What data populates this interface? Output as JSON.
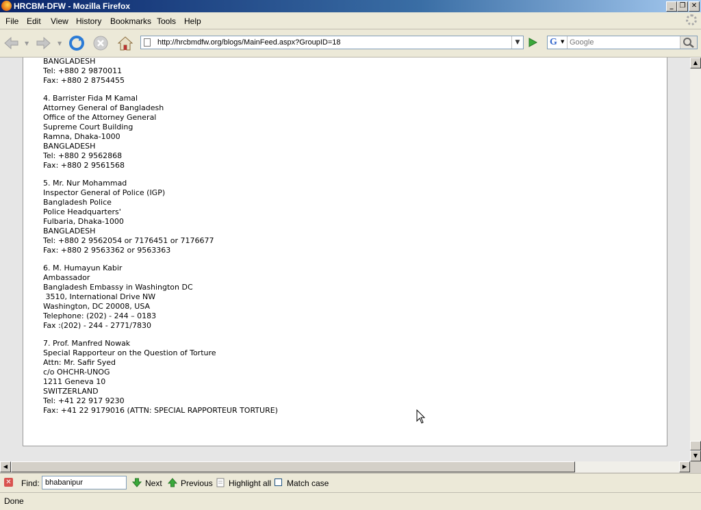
{
  "window": {
    "title": "HRCBM-DFW - Mozilla Firefox"
  },
  "menu": [
    "File",
    "Edit",
    "View",
    "History",
    "Bookmarks",
    "Tools",
    "Help"
  ],
  "nav": {
    "url": "http://hrcbmdfw.org/blogs/MainFeed.aspx?GroupID=18",
    "search_placeholder": "Google",
    "search_engine": "G"
  },
  "content": {
    "blocks": [
      [
        "BANGLADESH",
        "Tel: +880 2 9870011",
        "Fax: +880 2 8754455"
      ],
      [
        "4. Barrister Fida M Kamal",
        "Attorney General of Bangladesh",
        "Office of the Attorney General",
        "Supreme Court Building",
        "Ramna, Dhaka-1000",
        "BANGLADESH",
        "Tel: +880 2 9562868",
        "Fax: +880 2 9561568"
      ],
      [
        "5. Mr. Nur Mohammad",
        "Inspector General of Police (IGP)",
        "Bangladesh Police",
        "Police Headquarters'",
        "Fulbaria, Dhaka-1000",
        "BANGLADESH",
        "Tel: +880 2 9562054 or 7176451 or 7176677",
        "Fax: +880 2 9563362 or 9563363"
      ],
      [
        "6. M. Humayun Kabir",
        "Ambassador",
        "Bangladesh Embassy in Washington DC",
        " 3510, International Drive NW",
        "Washington, DC 20008, USA",
        "Telephone: (202) - 244 – 0183",
        "Fax :(202) - 244 - 2771/7830"
      ],
      [
        "7. Prof. Manfred Nowak",
        "Special Rapporteur on the Question of Torture",
        "Attn: Mr. Safir Syed",
        "c/o OHCHR-UNOG",
        "1211 Geneva 10",
        "SWITZERLAND",
        "Tel: +41 22 917 9230",
        "Fax: +41 22 9179016 (ATTN: SPECIAL RAPPORTEUR TORTURE)"
      ]
    ]
  },
  "findbar": {
    "find_label": "Find:",
    "find_value": "bhabanipur",
    "next_label": "Next",
    "previous_label": "Previous",
    "highlight_label": "Highlight all",
    "match_case_label": "Match case"
  },
  "status": {
    "text": "Done"
  }
}
